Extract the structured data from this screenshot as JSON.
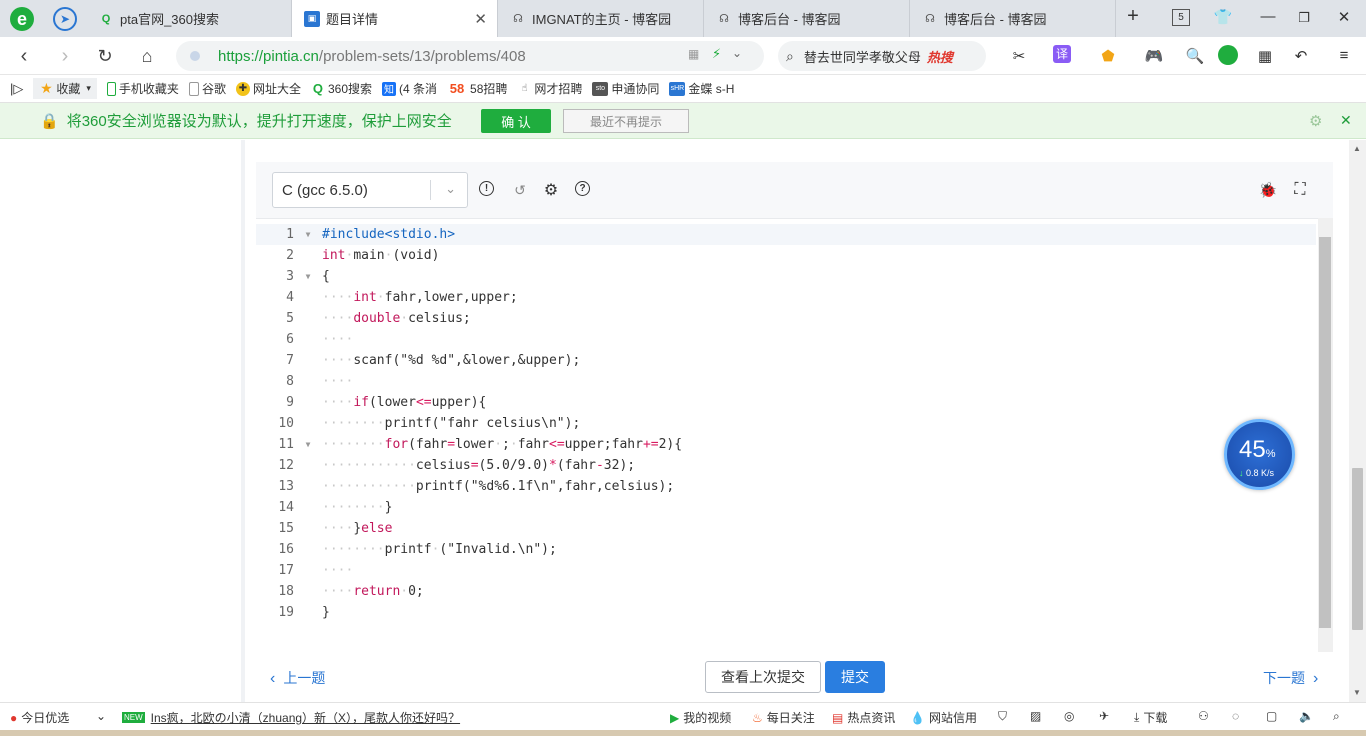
{
  "browser": {
    "tabs": [
      {
        "label": "pta官网_360搜索",
        "icon": "360-search-icon"
      },
      {
        "label": "题目详情",
        "icon": "pintia-icon"
      },
      {
        "label": "IMGNAT的主页 - 博客园",
        "icon": "cnblogs-icon"
      },
      {
        "label": "博客后台 - 博客园",
        "icon": "cnblogs-icon"
      },
      {
        "label": "博客后台 - 博客园",
        "icon": "cnblogs-icon"
      }
    ],
    "tab_count": "5",
    "url": {
      "scheme_host": "https://pintia.cn",
      "path": "/problem-sets/13/problems/408"
    },
    "search_text": "替去世同学孝敬父母",
    "search_badge": "热搜",
    "translate_label": "译"
  },
  "bookmarks": [
    {
      "label": "收藏",
      "icon": "star-icon"
    },
    {
      "label": "手机收藏夹",
      "icon": "phone-icon"
    },
    {
      "label": "谷歌",
      "icon": "page-icon"
    },
    {
      "label": "网址大全",
      "icon": "nav-icon"
    },
    {
      "label": "360搜索",
      "icon": "360-search-icon"
    },
    {
      "label": "(4 条消",
      "icon": "zhihu-icon"
    },
    {
      "label": "58招聘",
      "icon": "58-icon"
    },
    {
      "label": "网才招聘",
      "icon": "hand-icon"
    },
    {
      "label": "申通协同",
      "icon": "sto-icon"
    },
    {
      "label": "金蝶 s-H",
      "icon": "kingdee-icon"
    }
  ],
  "notice": {
    "text": "将360安全浏览器设为默认，提升打开速度，保护上网安全",
    "confirm": "确 认",
    "dismiss": "最近不再提示"
  },
  "editor": {
    "language": "C (gcc 6.5.0)",
    "lines": [
      {
        "n": "1",
        "text": "#include<stdio.h>"
      },
      {
        "n": "2",
        "text": "int main (void)"
      },
      {
        "n": "3",
        "text": "{"
      },
      {
        "n": "4",
        "text": "    int fahr,lower,upper;"
      },
      {
        "n": "5",
        "text": "    double celsius;"
      },
      {
        "n": "6",
        "text": "    "
      },
      {
        "n": "7",
        "text": "    scanf(\"%d %d\",&lower,&upper);"
      },
      {
        "n": "8",
        "text": "    "
      },
      {
        "n": "9",
        "text": "    if(lower<=upper){"
      },
      {
        "n": "10",
        "text": "        printf(\"fahr celsius\\n\");"
      },
      {
        "n": "11",
        "text": "        for(fahr=lower ; fahr<=upper;fahr+=2){"
      },
      {
        "n": "12",
        "text": "            celsius=(5.0/9.0)*(fahr-32);"
      },
      {
        "n": "13",
        "text": "            printf(\"%d%6.1f\\n\",fahr,celsius);"
      },
      {
        "n": "14",
        "text": "        }"
      },
      {
        "n": "15",
        "text": "    }else"
      },
      {
        "n": "16",
        "text": "        printf (\"Invalid.\\n\");"
      },
      {
        "n": "17",
        "text": "    "
      },
      {
        "n": "18",
        "text": "    return 0;"
      },
      {
        "n": "19",
        "text": "}"
      }
    ]
  },
  "actions": {
    "prev": "上一题",
    "next": "下一题",
    "last_submit": "查看上次提交",
    "submit": "提交"
  },
  "speed": {
    "percent": "45",
    "percent_unit": "%",
    "rate": "0.8 K/s"
  },
  "statusbar": {
    "today_pick": "今日优选",
    "news_badge": "NEW",
    "news_text": "Ins疯，北欧の小清（zhuang）新（X），尾款人你还好吗？",
    "my_video": "我的视频",
    "daily_follow": "每日关注",
    "hot_news": "热点资讯",
    "site_credit": "网站信用",
    "download": "下载"
  },
  "colors": {
    "accent_blue": "#2a7ee0",
    "notice_green": "#1f9d3a",
    "confirm_green": "#1fad3e",
    "keyword_pink": "#c2185b"
  }
}
